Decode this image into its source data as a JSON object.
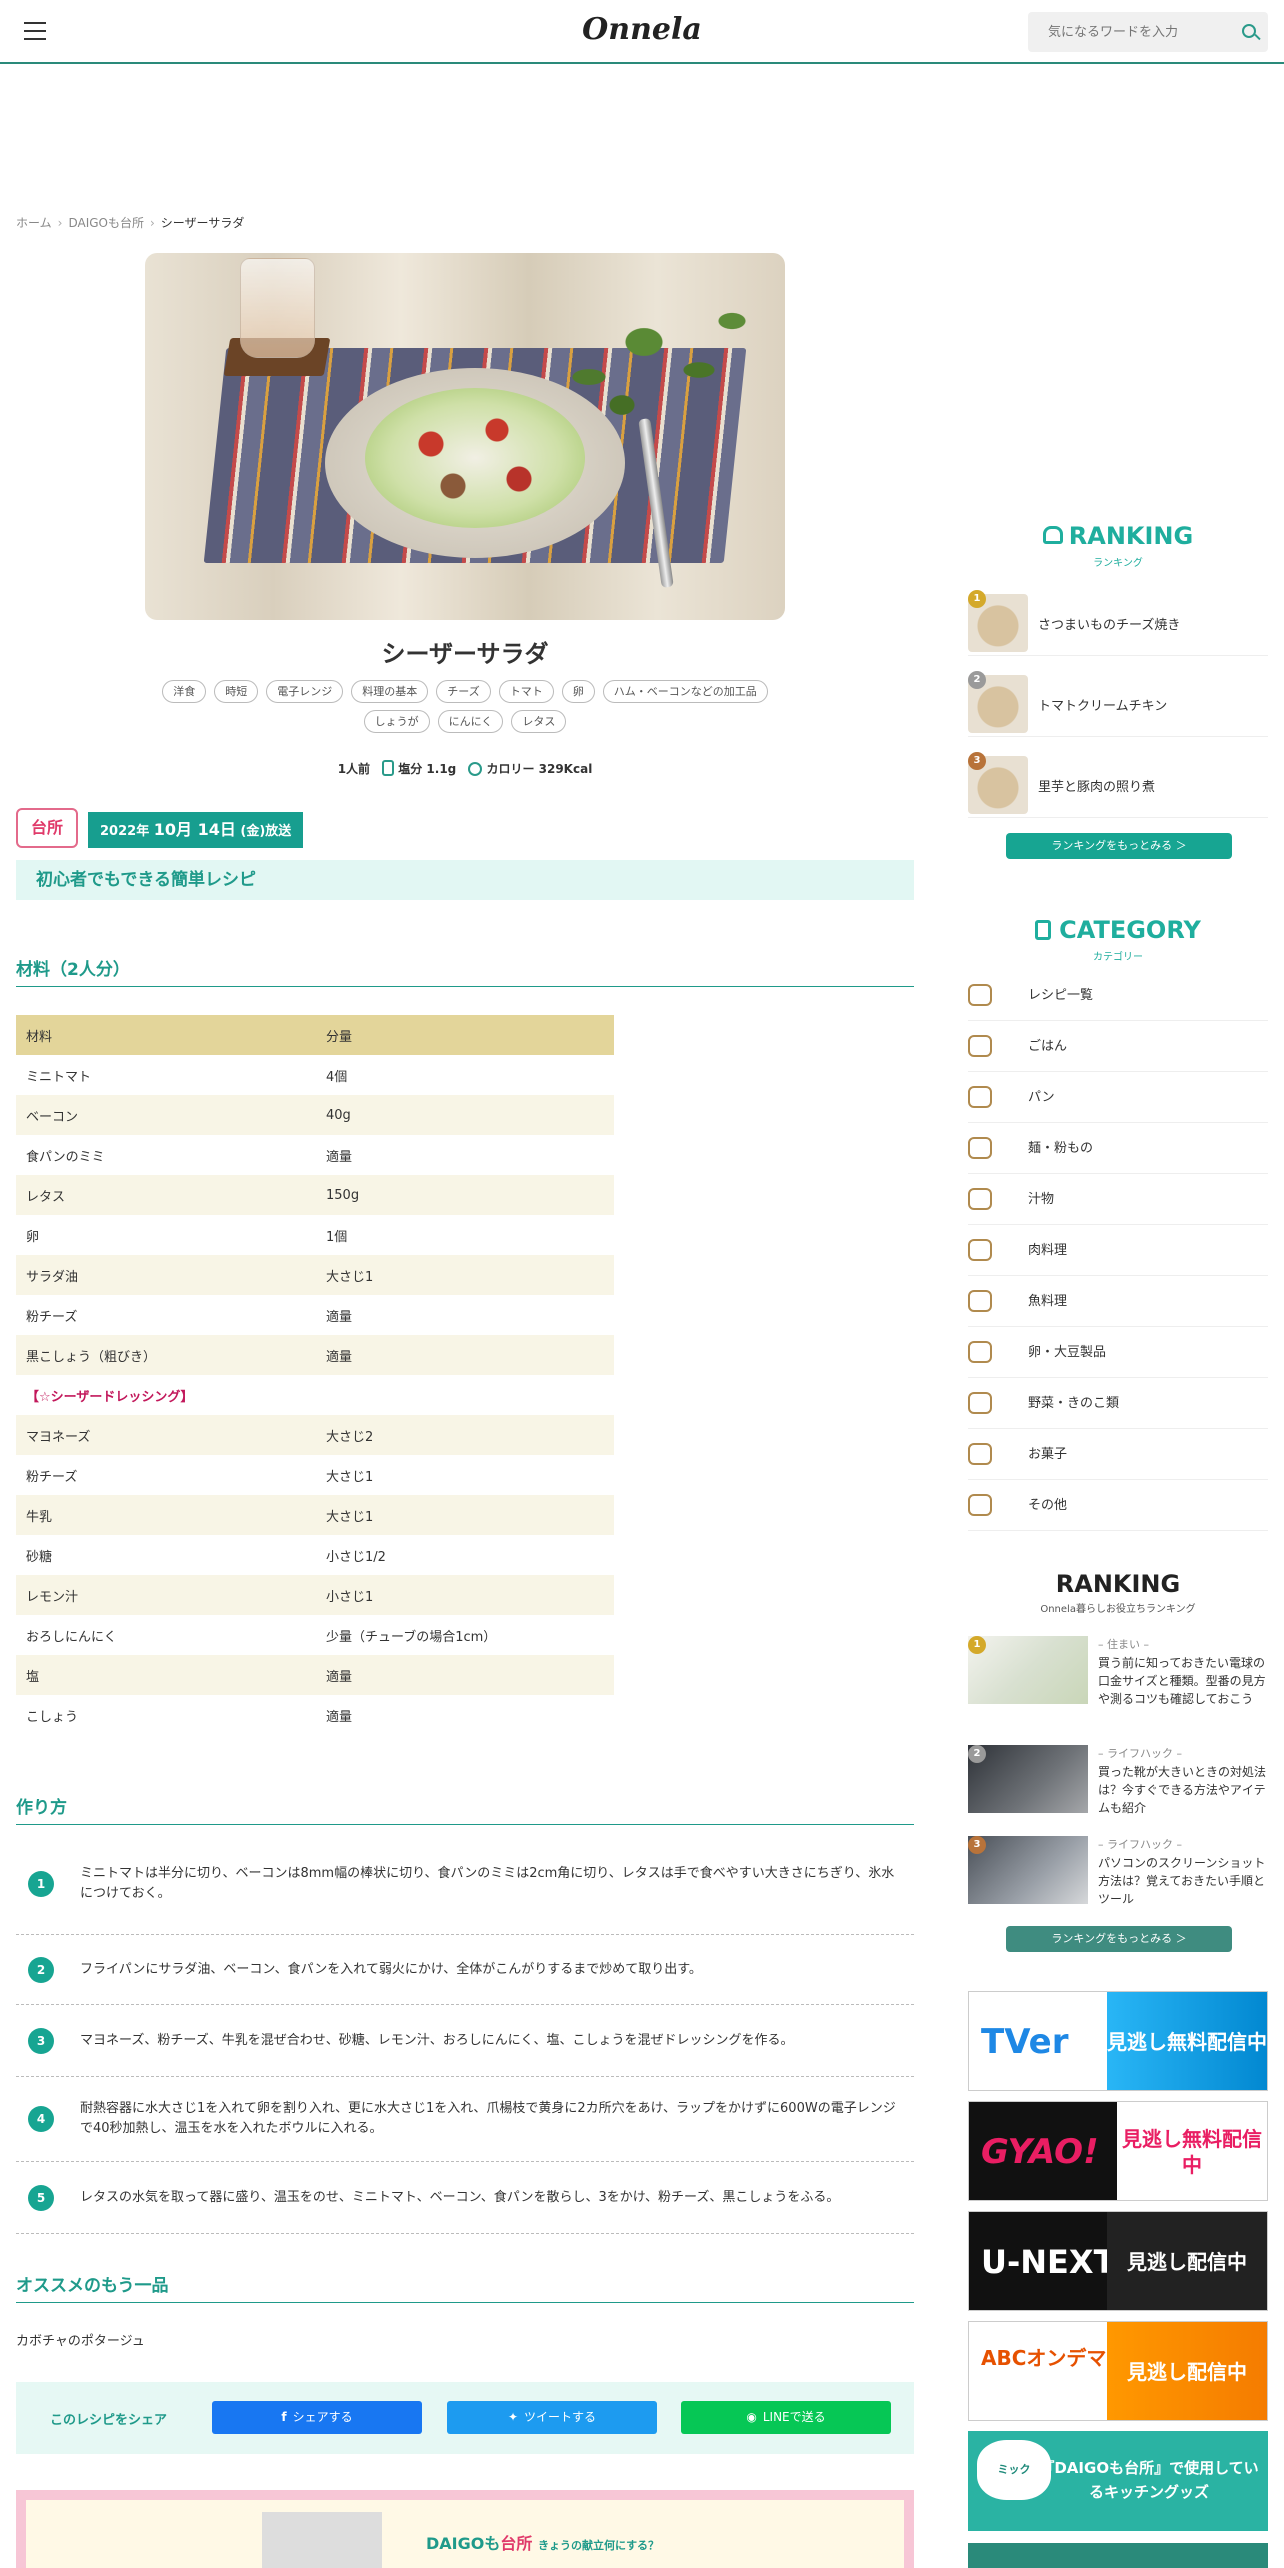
{
  "header": {
    "logo": "Onnela",
    "search_placeholder": "気になるワードを入力"
  },
  "breadcrumb": {
    "items": [
      "ホーム",
      "DAIGOも台所",
      "シーザーサラダ"
    ]
  },
  "recipe": {
    "title": "シーザーサラダ",
    "tags": [
      "洋食",
      "時短",
      "電子レンジ",
      "料理の基本",
      "チーズ",
      "トマト",
      "卵",
      "ハム・ベーコンなどの加工品",
      "しょうが",
      "にんにく",
      "レタス"
    ],
    "servings": "1人前",
    "salt": "塩分 1.1g",
    "calories": "カロリー 329Kcal",
    "show_logo": "台所",
    "airdate": {
      "year": "2022",
      "year_unit": "年",
      "date": "10月 14日",
      "weekday": "(金)",
      "suffix": "放送"
    },
    "catchcopy": "初心者でもできる簡単レシピ"
  },
  "ingredients": {
    "title": "材料（2人分）",
    "header": [
      "材料",
      "分量"
    ],
    "rows": [
      [
        "ミニトマト",
        "4個"
      ],
      [
        "ベーコン",
        "40g"
      ],
      [
        "食パンのミミ",
        "適量"
      ],
      [
        "レタス",
        "150g"
      ],
      [
        "卵",
        "1個"
      ],
      [
        "サラダ油",
        "大さじ1"
      ],
      [
        "粉チーズ",
        "適量"
      ],
      [
        "黒こしょう（粗びき）",
        "適量"
      ],
      [
        "【☆シーザードレッシング】",
        ""
      ],
      [
        "マヨネーズ",
        "大さじ2"
      ],
      [
        "粉チーズ",
        "大さじ1"
      ],
      [
        "牛乳",
        "大さじ1"
      ],
      [
        "砂糖",
        "小さじ1/2"
      ],
      [
        "レモン汁",
        "小さじ1"
      ],
      [
        "おろしにんにく",
        "少量（チューブの場合1cm）"
      ],
      [
        "塩",
        "適量"
      ],
      [
        "こしょう",
        "適量"
      ]
    ]
  },
  "method": {
    "title": "作り方",
    "steps": [
      "ミニトマトは半分に切り、ベーコンは8mm幅の棒状に切り、食パンのミミは2cm角に切り、レタスは手で食べやすい大きさにちぎり、氷水につけておく。",
      "フライパンにサラダ油、ベーコン、食パンを入れて弱火にかけ、全体がこんがりするまで炒めて取り出す。",
      "マヨネーズ、粉チーズ、牛乳を混ぜ合わせ、砂糖、レモン汁、おろしにんにく、塩、こしょうを混ぜドレッシングを作る。",
      "耐熱容器に水大さじ1を入れて卵を割り入れ、更に水大さじ1を入れ、爪楊枝で黄身に2カ所穴をあけ、ラップをかけずに600Wの電子レンジで40秒加熱し、温玉を水を入れたボウルに入れる。",
      "レタスの水気を取って器に盛り、温玉をのせ、ミニトマト、ベーコン、食パンを散らし、3をかけ、粉チーズ、黒こしょうをふる。"
    ]
  },
  "recommend": {
    "title": "オススメのもう一品",
    "item": "カボチャのポタージュ"
  },
  "share": {
    "label": "このレシピをシェア",
    "facebook": "シェアする",
    "twitter": "ツイートする",
    "line": "LINEで送る"
  },
  "promo": {
    "title": "DAIGOも",
    "title_pink": "台所",
    "sub": "きょうの献立何にする？"
  },
  "sidebar": {
    "ranking": {
      "title": "RANKING",
      "subtitle": "ランキング",
      "items": [
        {
          "rank": "1",
          "label": "さつまいものチーズ焼き"
        },
        {
          "rank": "2",
          "label": "トマトクリームチキン"
        },
        {
          "rank": "3",
          "label": "里芋と豚肉の照り煮"
        }
      ],
      "more": "ランキングをもっとみる ＞"
    },
    "category": {
      "title": "CATEGORY",
      "subtitle": "カテゴリー",
      "items": [
        {
          "label": "レシピ一覧",
          "icon": "utensils-icon"
        },
        {
          "label": "ごはん",
          "icon": "rice-bowl-icon"
        },
        {
          "label": "パン",
          "icon": "bread-icon"
        },
        {
          "label": "麺・粉もの",
          "icon": "noodle-icon"
        },
        {
          "label": "汁物",
          "icon": "soup-icon"
        },
        {
          "label": "肉料理",
          "icon": "meat-icon"
        },
        {
          "label": "魚料理",
          "icon": "fish-icon"
        },
        {
          "label": "卵・大豆製品",
          "icon": "egg-icon"
        },
        {
          "label": "野菜・きのこ類",
          "icon": "vegetable-icon"
        },
        {
          "label": "お菓子",
          "icon": "sweets-icon"
        },
        {
          "label": "その他",
          "icon": "pot-icon"
        }
      ]
    },
    "ranking2": {
      "title": "RANKING",
      "subtitle": "Onnela暮らしお役立ちランキング",
      "items": [
        {
          "rank": "1",
          "category": "– 住まい –",
          "title": "買う前に知っておきたい電球の口金サイズと種類。型番の見方や測るコツも確認しておこう"
        },
        {
          "rank": "2",
          "category": "– ライフハック –",
          "title": "買った靴が大きいときの対処法は？今すぐできる方法やアイテムも紹介"
        },
        {
          "rank": "3",
          "category": "– ライフハック –",
          "title": "パソコンのスクリーンショット方法は？覚えておきたい手順とツール"
        }
      ],
      "more": "ランキングをもっとみる ＞"
    },
    "banners": [
      {
        "logo": "TVer",
        "text": "見逃し無料配信中"
      },
      {
        "logo": "GYAO!",
        "text": "見逃し無料配信中"
      },
      {
        "logo": "U-NEXT",
        "text": "見逃し配信中"
      },
      {
        "logo": "ABCオンデマンド",
        "text": "見逃し配信中"
      },
      {
        "logo": "ミック",
        "text": "『DAIGOも台所』で使用しているキッチングッズ"
      }
    ]
  }
}
